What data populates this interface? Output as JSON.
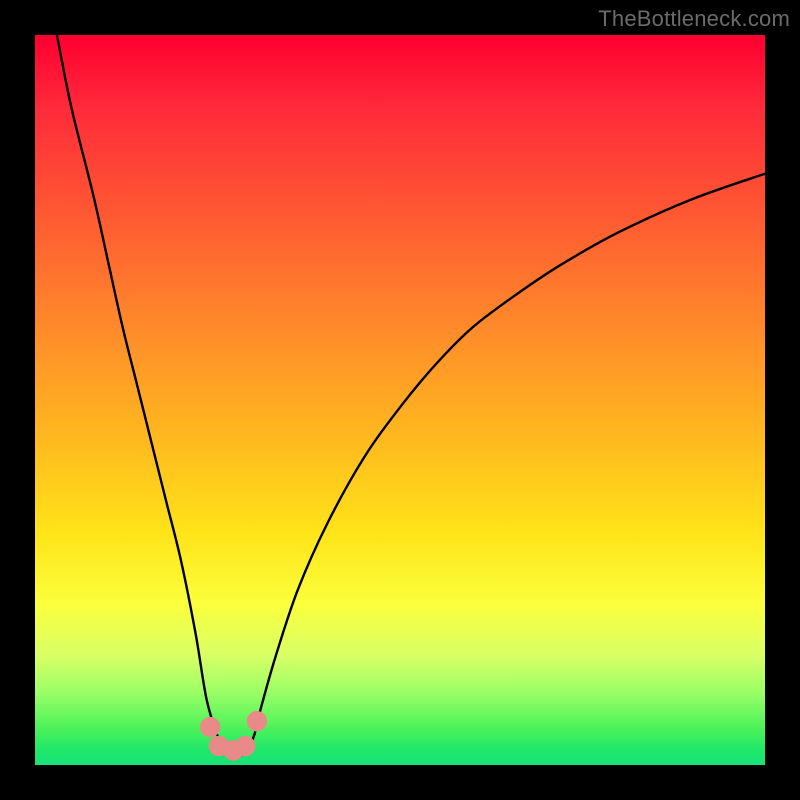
{
  "watermark": "TheBottleneck.com",
  "chart_data": {
    "type": "line",
    "title": "",
    "xlabel": "",
    "ylabel": "",
    "xlim": [
      0,
      100
    ],
    "ylim": [
      0,
      100
    ],
    "grid": false,
    "series": [
      {
        "name": "bottleneck-curve",
        "x": [
          3,
          5,
          8,
          10,
          12,
          14,
          16,
          18,
          20,
          22,
          23.5,
          25,
          26,
          27,
          28,
          29,
          30,
          31,
          33,
          36,
          40,
          45,
          50,
          55,
          60,
          66,
          72,
          80,
          90,
          100
        ],
        "y": [
          100,
          90,
          78,
          69,
          60,
          52,
          44,
          36,
          28,
          18,
          9,
          4,
          2,
          1.2,
          1.2,
          2,
          4,
          8,
          15,
          24,
          33,
          42,
          49,
          55,
          60,
          64.5,
          68.5,
          73,
          77.5,
          81
        ]
      }
    ],
    "markers": [
      {
        "shape": "circle",
        "x": 24.0,
        "y": 5.2,
        "r": 1.4,
        "color": "#e98a88"
      },
      {
        "shape": "circle",
        "x": 25.2,
        "y": 2.6,
        "r": 1.4,
        "color": "#e98a88"
      },
      {
        "shape": "circle",
        "x": 27.2,
        "y": 2.0,
        "r": 1.4,
        "color": "#e98a88"
      },
      {
        "shape": "circle",
        "x": 28.8,
        "y": 2.6,
        "r": 1.4,
        "color": "#e98a88"
      },
      {
        "shape": "circle",
        "x": 30.4,
        "y": 6.0,
        "r": 1.4,
        "color": "#e98a88"
      }
    ]
  }
}
